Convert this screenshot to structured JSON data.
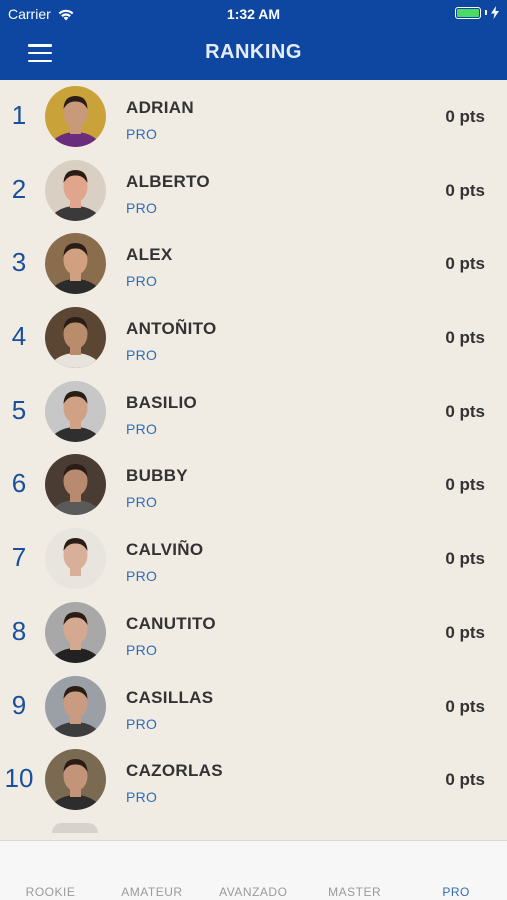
{
  "status_bar": {
    "carrier": "Carrier",
    "time": "1:32 AM"
  },
  "header": {
    "title": "RANKING"
  },
  "colors": {
    "header_bg": "#0d47a1",
    "accent": "#2f6db6",
    "page_bg": "#f0ebe3"
  },
  "ranking": [
    {
      "rank": "1",
      "name": "ADRIAN",
      "level": "PRO",
      "points": "0 pts",
      "avatar_bg": "#c9a23a",
      "skin": "#c99a7a",
      "shirt": "#6b2c7e"
    },
    {
      "rank": "2",
      "name": "ALBERTO",
      "level": "PRO",
      "points": "0 pts",
      "avatar_bg": "#d9d0c3",
      "skin": "#e0a58c",
      "shirt": "#3a3a3a"
    },
    {
      "rank": "3",
      "name": "ALEX",
      "level": "PRO",
      "points": "0 pts",
      "avatar_bg": "#8a6d4d",
      "skin": "#d1a080",
      "shirt": "#2b2b2b"
    },
    {
      "rank": "4",
      "name": "ANTOÑITO",
      "level": "PRO",
      "points": "0 pts",
      "avatar_bg": "#5a4632",
      "skin": "#b98d6c",
      "shirt": "#e8e3dc"
    },
    {
      "rank": "5",
      "name": "BASILIO",
      "level": "PRO",
      "points": "0 pts",
      "avatar_bg": "#c7c7c7",
      "skin": "#d0a184",
      "shirt": "#2f2f2f"
    },
    {
      "rank": "6",
      "name": "BUBBY",
      "level": "PRO",
      "points": "0 pts",
      "avatar_bg": "#4a3b33",
      "skin": "#b88b70",
      "shirt": "#5a5a5a"
    },
    {
      "rank": "7",
      "name": "CALVIÑO",
      "level": "PRO",
      "points": "0 pts",
      "avatar_bg": "#e8e4de",
      "skin": "#d8b09a",
      "shirt": "#e8e4de"
    },
    {
      "rank": "8",
      "name": "CANUTITO",
      "level": "PRO",
      "points": "0 pts",
      "avatar_bg": "#a8a8a8",
      "skin": "#d4a98f",
      "shirt": "#222222"
    },
    {
      "rank": "9",
      "name": "CASILLAS",
      "level": "PRO",
      "points": "0 pts",
      "avatar_bg": "#9aa0a6",
      "skin": "#c99b80",
      "shirt": "#3d3d3d"
    },
    {
      "rank": "10",
      "name": "CAZORLAS",
      "level": "PRO",
      "points": "0 pts",
      "avatar_bg": "#7a6a52",
      "skin": "#c49478",
      "shirt": "#2d2d2d"
    }
  ],
  "tabs": [
    {
      "label": "ROOKIE",
      "active": false
    },
    {
      "label": "AMATEUR",
      "active": false
    },
    {
      "label": "AVANZADO",
      "active": false
    },
    {
      "label": "MASTER",
      "active": false
    },
    {
      "label": "PRO",
      "active": true
    }
  ]
}
